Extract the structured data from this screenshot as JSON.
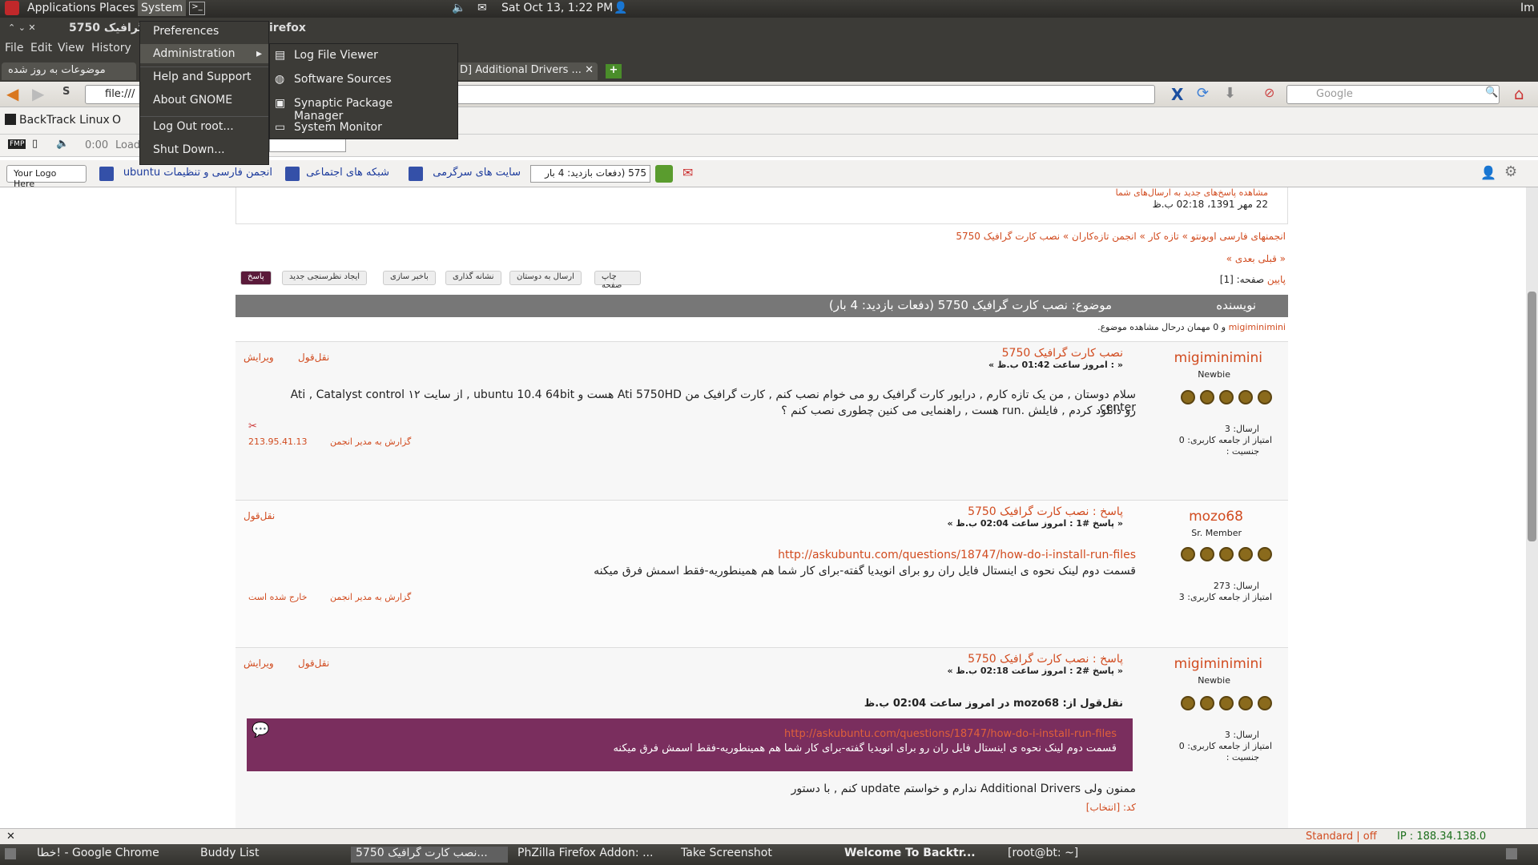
{
  "topbar": {
    "applications": "Applications",
    "places": "Places",
    "system": "System",
    "clock": "Sat Oct 13,  1:22 PM",
    "user": "Im"
  },
  "window": {
    "title": "5750 گرافیک",
    "title_suffix": "irefox"
  },
  "menubar": {
    "file": "File",
    "edit": "Edit",
    "view": "View",
    "history": "History"
  },
  "system_menu": {
    "preferences": "Preferences",
    "administration": "Administration",
    "help": "Help and Support",
    "about": "About GNOME",
    "logout": "Log Out root...",
    "shutdown": "Shut Down..."
  },
  "admin_submenu": [
    "Log File Viewer",
    "Software Sources",
    "Synaptic Package Manager",
    "System Monitor"
  ],
  "tabs": {
    "left": "موضوعات به روز شده",
    "right": "D] Additional Drivers ..."
  },
  "nav": {
    "url": "file:///",
    "search_placeholder": "Google"
  },
  "bookmarks": {
    "bt": "BackTrack Linux",
    "o": "O"
  },
  "media": {
    "time": "0:00",
    "load": "Load"
  },
  "toolbar2": {
    "logo": "Your Logo Here",
    "forum": "انجمن فارسی و تنظیمات ubuntu",
    "social": "شبکه های اجتماعی",
    "fun": "سایت های سرگرمی",
    "field": "575  (دفعات بازدید: 4 بار"
  },
  "page": {
    "top_note": "مشاهده پاسخ‌های جدید به ارسال‌های شما",
    "top_date": "22 مهر 1391، 02:18 ب.ظ",
    "breadcrumb": "انجمنهای فارسی اوبونتو » تازه کار » انجمن تازه‌کاران » نصب کارت گرافیک 5750",
    "prevnext": "« قبلی بعدی »",
    "pages": "صفحه: [1]",
    "pages_link": "پایین",
    "buttons": [
      "پاسخ",
      "ایجاد نظرسنجی جدید",
      "باخبر سازی",
      "نشانه گذاری",
      "ارسال به دوستان",
      "چاپ صفحه"
    ],
    "header_author": "نویسنده",
    "header_topic": "موضوع: نصب کارت گرافیک 5750  (دفعات بازدید: 4 بار)",
    "viewers_link": "migiminimini",
    "viewers": " و 0 مهمان درحال مشاهده موضوع."
  },
  "posts": [
    {
      "author": "migiminimini",
      "rank": "Newbie",
      "posts": "ارسال: 3",
      "karma": "امتیاز از جامعه کاربری: 0",
      "gender": "جنسیت :",
      "title": "نصب کارت گرافیک 5750",
      "meta": "« : امروز ساعت 01:42 ب.ظ »",
      "quote": "نقل‌قول",
      "edit": "ویرایش",
      "body1": "سلام دوستان , من یک تازه کارم , درایور کارت گرافیک رو می خوام نصب کنم , کارت گرافیک من Ati 5750HD هست و ubuntu 10.4 64bit , از سایت ۱۲ Ati , Catalyst control center",
      "body2": "رو دانلود کردم , فایلش .run هست , راهنمایی می کنین چطوری نصب کنم ؟",
      "report": "گزارش به مدیر انجمن",
      "ip": "213.95.41.13"
    },
    {
      "author": "mozo68",
      "rank": "Sr. Member",
      "posts": "ارسال: 273",
      "karma": "امتیاز از جامعه کاربری: 3",
      "title": "پاسخ : نصب کارت گرافیک 5750",
      "meta": "« پاسخ #1 : امروز ساعت 02:04 ب.ظ »",
      "quote": "نقل‌قول",
      "link": "http://askubuntu.com/questions/18747/how-do-i-install-run-files",
      "body": "قسمت دوم لینک نحوه ی اینستال فایل ران رو برای انویدیا گفته-برای کار شما هم همینطوریه-فقط اسمش فرق میکنه",
      "report": "گزارش به مدیر انجمن",
      "ip": "خارج شده است"
    },
    {
      "author": "migiminimini",
      "rank": "Newbie",
      "posts": "ارسال: 3",
      "karma": "امتیاز از جامعه کاربری: 0",
      "gender": "جنسیت :",
      "title": "پاسخ : نصب کارت گرافیک 5750",
      "meta": "« پاسخ #2 : امروز ساعت 02:18 ب.ظ »",
      "quote": "نقل‌قول",
      "edit": "ویرایش",
      "quote_head": "نقل‌قول از: mozo68 در امروز ساعت 02:04 ب.ظ",
      "quote_link": "http://askubuntu.com/questions/18747/how-do-i-install-run-files",
      "quote_body": "قسمت دوم لینک نحوه ی اینستال فایل ران رو برای انویدیا گفته-برای کار شما هم همینطوریه-فقط اسمش فرق میکنه",
      "body": "ممنون ولی Additional Drivers ندارم و خواستم update کنم , با دستور",
      "code": "کد: [انتخاب]"
    }
  ],
  "statusbar": {
    "mode": "Standard | off",
    "ip": "IP : 188.34.138.0"
  },
  "taskbar": [
    "خطا! - Google Chrome",
    "Buddy List",
    "نصب کارت گرافیک 5750...",
    "PhZilla Firefox Addon: ...",
    "Take Screenshot",
    "Welcome To Backtr...",
    "[root@bt: ~]"
  ],
  "colors": {
    "accent": "#d14b1f",
    "quote_bg": "#7a2e5e",
    "panel": "#3c3b37"
  }
}
